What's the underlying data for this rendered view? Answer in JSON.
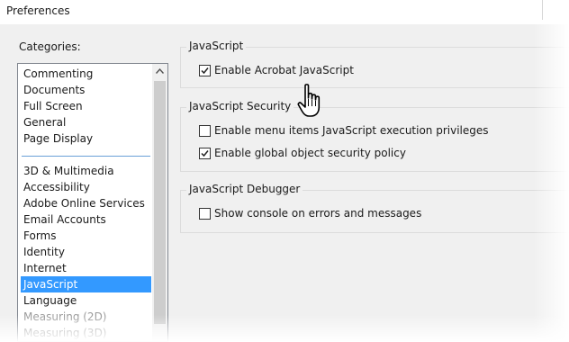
{
  "window": {
    "title": "Preferences"
  },
  "categories": {
    "label": "Categories:",
    "group1": [
      "Commenting",
      "Documents",
      "Full Screen",
      "General",
      "Page Display"
    ],
    "group2": [
      "3D & Multimedia",
      "Accessibility",
      "Adobe Online Services",
      "Email Accounts",
      "Forms",
      "Identity",
      "Internet",
      "JavaScript",
      "Language",
      "Measuring (2D)",
      "Measuring (3D)"
    ],
    "selected": "JavaScript"
  },
  "groups": {
    "javascript": {
      "legend": "JavaScript",
      "enable_acrobat_js": {
        "label": "Enable Acrobat JavaScript",
        "checked": true
      }
    },
    "security": {
      "legend": "JavaScript Security",
      "enable_menu_items": {
        "label": "Enable menu items JavaScript execution privileges",
        "checked": false
      },
      "enable_global_policy": {
        "label": "Enable global object security policy",
        "checked": true
      }
    },
    "debugger": {
      "legend": "JavaScript Debugger",
      "show_console": {
        "label": "Show console on errors and messages",
        "checked": false
      }
    }
  },
  "icons": {
    "scroll_up": "scroll-up-arrow-icon",
    "cursor": "hand-pointer-icon",
    "checkmark": "checkmark-icon"
  },
  "colors": {
    "selection": "#3399ff",
    "dialog_background": "#f0f0f0"
  }
}
